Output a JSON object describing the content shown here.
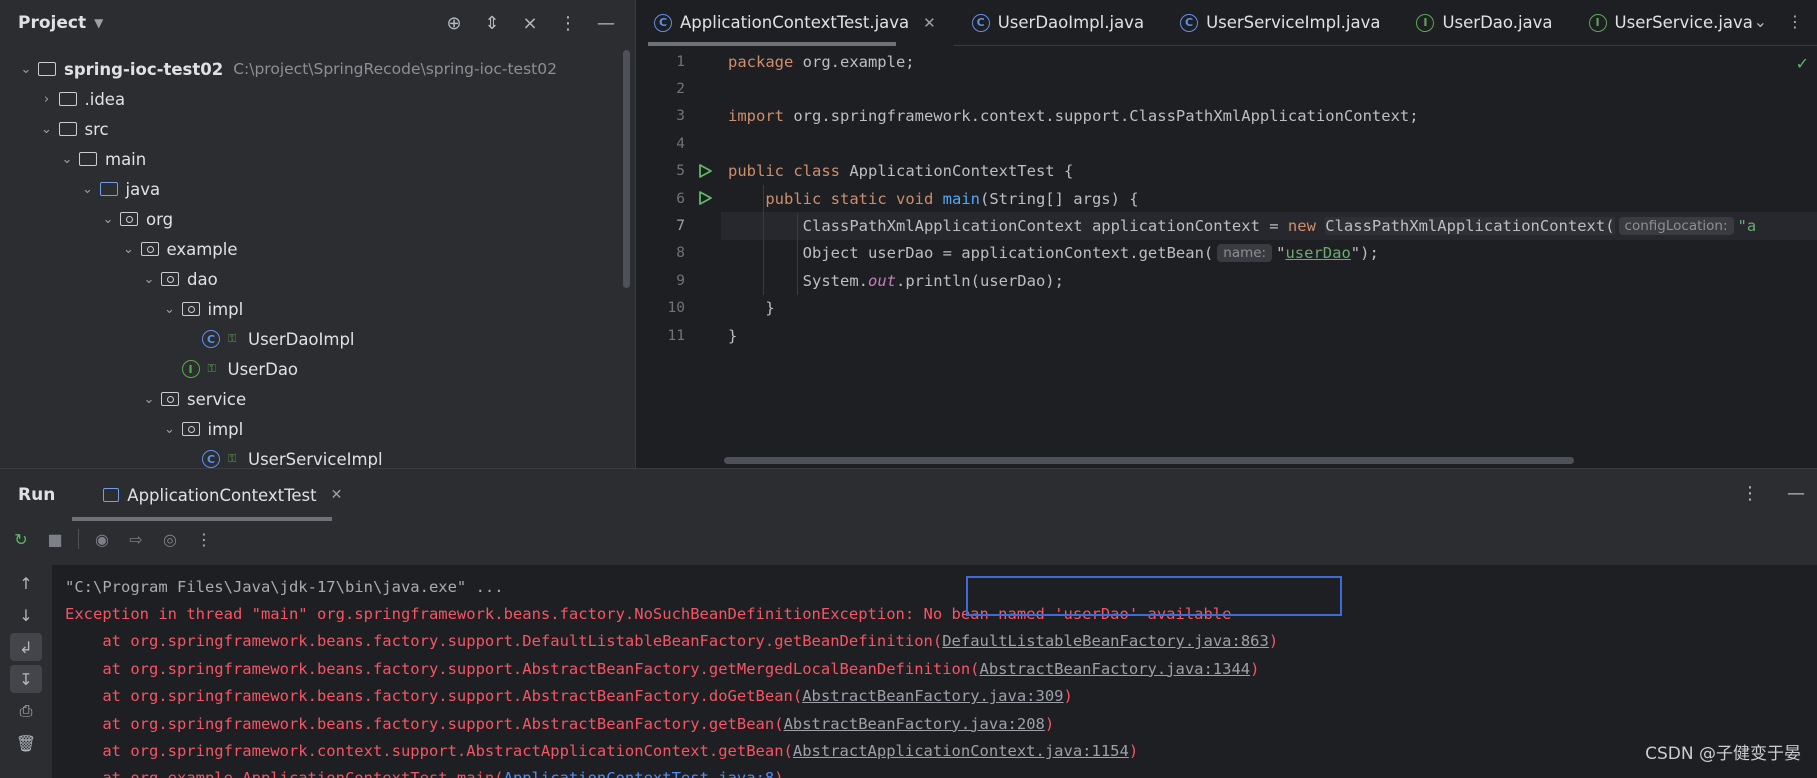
{
  "project": {
    "title": "Project",
    "tree": [
      {
        "label": "spring-ioc-test02",
        "path": "C:\\project\\SpringRecode\\spring-ioc-test02",
        "depth": 0,
        "arrow": "open",
        "icon": "module-folder-icon",
        "bold": true
      },
      {
        "label": ".idea",
        "depth": 1,
        "arrow": "closed",
        "icon": "folder-icon"
      },
      {
        "label": "src",
        "depth": 1,
        "arrow": "open",
        "icon": "folder-icon"
      },
      {
        "label": "main",
        "depth": 2,
        "arrow": "open",
        "icon": "folder-icon"
      },
      {
        "label": "java",
        "depth": 3,
        "arrow": "open",
        "icon": "source-folder-icon"
      },
      {
        "label": "org",
        "depth": 4,
        "arrow": "open",
        "icon": "package-icon"
      },
      {
        "label": "example",
        "depth": 5,
        "arrow": "open",
        "icon": "package-icon"
      },
      {
        "label": "dao",
        "depth": 6,
        "arrow": "open",
        "icon": "package-icon"
      },
      {
        "label": "impl",
        "depth": 7,
        "arrow": "open",
        "icon": "package-icon"
      },
      {
        "label": "UserDaoImpl",
        "depth": 8,
        "arrow": "none",
        "icon": "class-icon",
        "lock": true
      },
      {
        "label": "UserDao",
        "depth": 7,
        "arrow": "none",
        "icon": "interface-icon",
        "lock": true
      },
      {
        "label": "service",
        "depth": 6,
        "arrow": "open",
        "icon": "package-icon"
      },
      {
        "label": "impl",
        "depth": 7,
        "arrow": "open",
        "icon": "package-icon"
      },
      {
        "label": "UserServiceImpl",
        "depth": 8,
        "arrow": "none",
        "icon": "class-icon",
        "lock": true
      }
    ]
  },
  "editor": {
    "tabs": [
      {
        "label": "ApplicationContextTest.java",
        "icon": "class-icon",
        "active": true,
        "closable": true
      },
      {
        "label": "UserDaoImpl.java",
        "icon": "class-icon"
      },
      {
        "label": "UserServiceImpl.java",
        "icon": "class-icon"
      },
      {
        "label": "UserDao.java",
        "icon": "interface-icon"
      },
      {
        "label": "UserService.java",
        "icon": "interface-icon"
      }
    ],
    "current_line": 7,
    "run_markers": [
      5,
      6
    ],
    "lines": [
      [
        {
          "t": "package ",
          "c": "kw"
        },
        {
          "t": "org.example;"
        }
      ],
      [],
      [
        {
          "t": "import ",
          "c": "kw"
        },
        {
          "t": "org.springframework.context.support.ClassPathXmlApplicationContext;"
        }
      ],
      [],
      [
        {
          "t": "public ",
          "c": "kw"
        },
        {
          "t": "class ",
          "c": "kw"
        },
        {
          "t": "ApplicationContextTest {"
        }
      ],
      [
        {
          "t": "    "
        },
        {
          "t": "public ",
          "c": "kw"
        },
        {
          "t": "static ",
          "c": "kw"
        },
        {
          "t": "void ",
          "c": "kw"
        },
        {
          "t": "main",
          "c": "fn"
        },
        {
          "t": "(String[] args) {"
        }
      ],
      [
        {
          "t": "        ClassPathXmlApplicationContext applicationContext = "
        },
        {
          "t": "new ",
          "c": "kw"
        },
        {
          "t": "ClassPathXmlApplicationContext(",
          "c": "hl-cls"
        },
        {
          "t": "configLocation:",
          "c": "hint"
        },
        {
          "t": "\"a",
          "c": "str"
        }
      ],
      [
        {
          "t": "        Object userDao = applicationContext.getBean("
        },
        {
          "t": "name:",
          "c": "hint"
        },
        {
          "t": "\""
        },
        {
          "t": "userDao",
          "c": "str-u"
        },
        {
          "t": "\");"
        }
      ],
      [
        {
          "t": "        System."
        },
        {
          "t": "out",
          "c": "ital"
        },
        {
          "t": ".println(userDao);"
        }
      ],
      [
        {
          "t": "    }"
        }
      ],
      [
        {
          "t": "}"
        }
      ]
    ]
  },
  "run": {
    "title": "Run",
    "tab_label": "ApplicationContextTest",
    "console": [
      {
        "parts": [
          {
            "t": "\"C:\\Program Files\\Java\\jdk-17\\bin\\java.exe\" ..."
          }
        ],
        "style": "gray"
      },
      {
        "parts": [
          {
            "t": "Exception in thread \"main\" org.springframework.beans.factory.NoSuchBeanDefinitionException: No bean named 'userDao' available"
          }
        ]
      },
      {
        "parts": [
          {
            "t": "    at org.springframework.beans.factory.support.DefaultListableBeanFactory.getBeanDefinition("
          },
          {
            "t": "DefaultListableBeanFactory.java:863",
            "link": true
          },
          {
            "t": ")"
          }
        ]
      },
      {
        "parts": [
          {
            "t": "    at org.springframework.beans.factory.support.AbstractBeanFactory.getMergedLocalBeanDefinition("
          },
          {
            "t": "AbstractBeanFactory.java:1344",
            "link": true
          },
          {
            "t": ")"
          }
        ]
      },
      {
        "parts": [
          {
            "t": "    at org.springframework.beans.factory.support.AbstractBeanFactory.doGetBean("
          },
          {
            "t": "AbstractBeanFactory.java:309",
            "link": true
          },
          {
            "t": ")"
          }
        ]
      },
      {
        "parts": [
          {
            "t": "    at org.springframework.beans.factory.support.AbstractBeanFactory.getBean("
          },
          {
            "t": "AbstractBeanFactory.java:208",
            "link": true
          },
          {
            "t": ")"
          }
        ]
      },
      {
        "parts": [
          {
            "t": "    at org.springframework.context.support.AbstractApplicationContext.getBean("
          },
          {
            "t": "AbstractApplicationContext.java:1154",
            "link": true
          },
          {
            "t": ")"
          }
        ]
      },
      {
        "parts": [
          {
            "t": "    at org.example.ApplicationContextTest.main("
          },
          {
            "t": "ApplicationContextTest.java:8",
            "link": true,
            "blue": true
          },
          {
            "t": ")"
          }
        ]
      }
    ]
  },
  "watermark": "CSDN @子健变于晏",
  "colors": {
    "keyword": "#cf8e6d",
    "error": "#f75464",
    "string": "#6aab73",
    "function": "#56a8f5",
    "annotation_box": "#3f6bd9"
  }
}
